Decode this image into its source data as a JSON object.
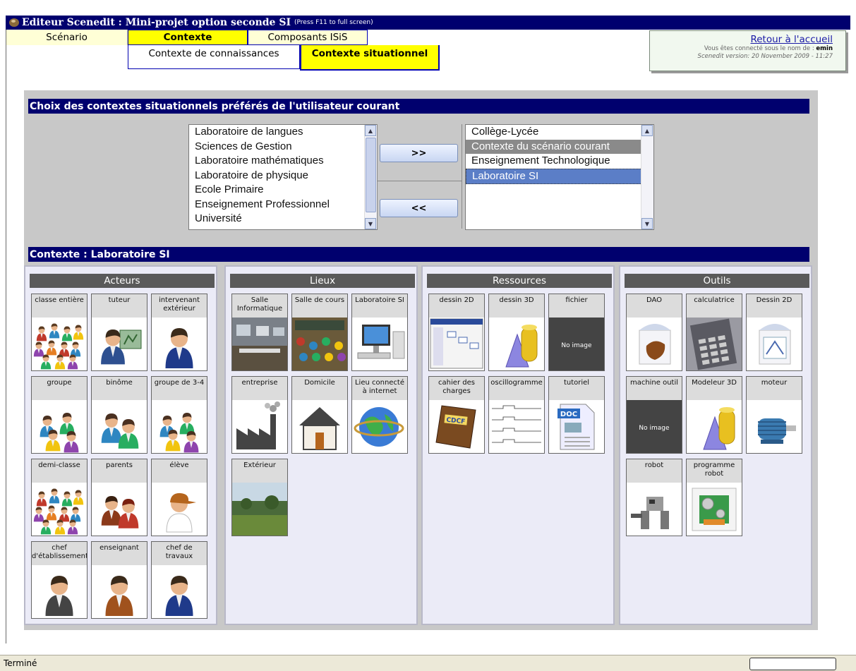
{
  "window": {
    "title": "Editeur Scenedit : Mini-projet option seconde SI",
    "hint": "(Press F11 to full screen)"
  },
  "tabs": {
    "scenario": "Scénario",
    "contexte": "Contexte",
    "composants": "Composants ISiS",
    "contexte_connaissances": "Contexte de connaissances",
    "contexte_situationnel": "Contexte situationnel"
  },
  "infobox": {
    "home_link": "Retour à l'accueil",
    "connected_prefix": "Vous êtes connecté sous le nom de : ",
    "user": "emin",
    "version": "Scenedit version: 20 November 2009 - 11:27"
  },
  "preferences": {
    "title": "Choix des contextes situationnels préférés de l'utilisateur courant",
    "available": [
      "Laboratoire de langues",
      "Sciences de Gestion",
      "Laboratoire mathématiques",
      "Laboratoire de physique",
      "Ecole Primaire",
      "Enseignement Professionnel",
      "Université"
    ],
    "selected": [
      "Collège-Lycée",
      "Contexte du scénario courant",
      "Enseignement Technologique",
      "Laboratoire SI"
    ],
    "add_button": ">>",
    "remove_button": "<<"
  },
  "context": {
    "title": "Contexte : Laboratoire SI",
    "columns": [
      {
        "name": "Acteurs",
        "items": [
          "classe entière",
          "tuteur",
          "intervenant extérieur",
          "groupe",
          "binôme",
          "groupe de 3-4",
          "demi-classe",
          "parents",
          "élève",
          "chef d'établissement",
          "enseignant",
          "chef de travaux"
        ]
      },
      {
        "name": "Lieux",
        "items": [
          "Salle Informatique",
          "Salle de cours",
          "Laboratoire SI",
          "entreprise",
          "Domicile",
          "Lieu connecté à internet",
          "Extérieur"
        ]
      },
      {
        "name": "Ressources",
        "items": [
          "dessin 2D",
          "dessin 3D",
          "fichier",
          "cahier des charges",
          "oscillogramme",
          "tutoriel"
        ]
      },
      {
        "name": "Outils",
        "items": [
          "DAO",
          "calculatrice",
          "Dessin 2D",
          "machine outil",
          "Modeleur 3D",
          "moteur",
          "robot",
          "programme robot"
        ]
      }
    ],
    "no_image": "No image",
    "doc_label": "DOC",
    "cdcf_label": "CDCF"
  },
  "status": {
    "text": "Terminé"
  },
  "colors": {
    "title_bar": "#00006e",
    "active_tab": "#ffff00",
    "tab_border": "#0000b0"
  }
}
